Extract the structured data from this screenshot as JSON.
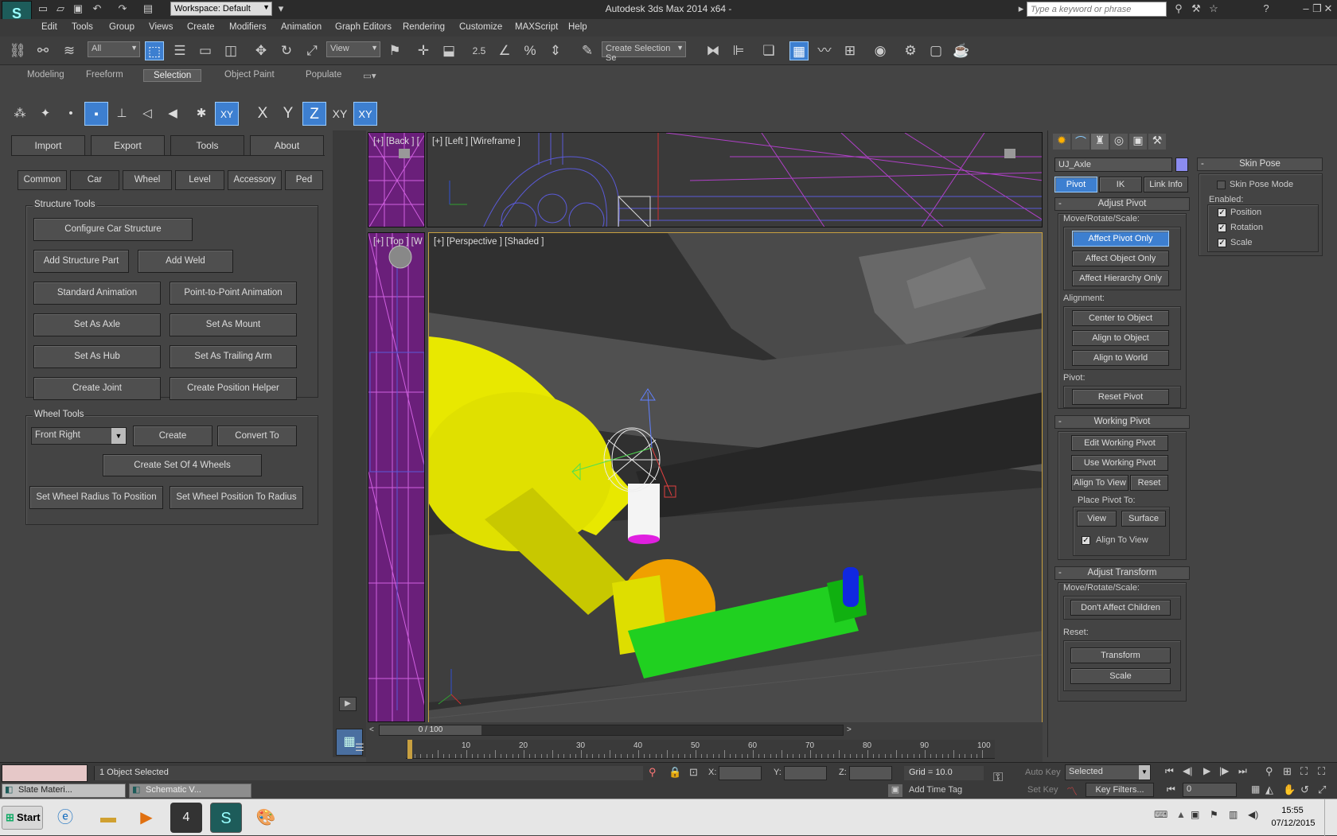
{
  "app": {
    "title": "Autodesk 3ds Max  2014 x64  -",
    "workspace_label": "Workspace: Default",
    "search_placeholder": "Type a keyword or phrase"
  },
  "menu": [
    "Edit",
    "Tools",
    "Group",
    "Views",
    "Create",
    "Modifiers",
    "Animation",
    "Graph Editors",
    "Rendering",
    "Customize",
    "MAXScript",
    "Help"
  ],
  "toolbar": {
    "filter_value": "All",
    "refcoord_value": "View",
    "selection_set_value": "Create Selection Se",
    "angle_snap_label": "2.5"
  },
  "ribbon_tabs": [
    "Modeling",
    "Freeform",
    "Selection",
    "Object Paint",
    "Populate"
  ],
  "ribbon_active": "Selection",
  "axis_buttons": [
    "X",
    "Y",
    "Z",
    "XY",
    "XY"
  ],
  "left_panel": {
    "tabs": [
      "Import",
      "Export",
      "Tools",
      "About"
    ],
    "active_tab": "Tools",
    "subtabs": [
      "Common",
      "Car",
      "Wheel",
      "Level",
      "Accessory",
      "Ped"
    ],
    "active_subtab": "Car",
    "structure_title": "Structure Tools",
    "structure_buttons": {
      "configure": "Configure Car Structure",
      "add_part": "Add Structure Part",
      "add_weld": "Add Weld",
      "std_anim": "Standard Animation",
      "p2p_anim": "Point-to-Point Animation",
      "set_axle": "Set As Axle",
      "set_mount": "Set As Mount",
      "set_hub": "Set As Hub",
      "set_trailing": "Set As Trailing Arm",
      "create_joint": "Create Joint",
      "create_pos_helper": "Create Position Helper"
    },
    "wheel_title": "Wheel Tools",
    "wheel_select_value": "Front Right",
    "wheel_buttons": {
      "create": "Create",
      "convert": "Convert To",
      "set_of_4": "Create Set Of 4 Wheels",
      "radius_to_pos": "Set Wheel Radius To Position",
      "pos_to_radius": "Set Wheel Position To Radius"
    }
  },
  "viewports": {
    "back": "[+] [Back ] [",
    "left": "[+] [Left ] [Wireframe ]",
    "top": "[+] [Top ] [W",
    "perspective": "[+] [Perspective ] [Shaded ]"
  },
  "command_panel": {
    "object_name": "UJ_Axle",
    "object_color": "#8c8cf0",
    "tabs": [
      "Pivot",
      "IK",
      "Link Info"
    ],
    "active_tab": "Pivot",
    "adjust_pivot_title": "Adjust Pivot",
    "move_rotate_scale": "Move/Rotate/Scale:",
    "affect_pivot_only": "Affect Pivot Only",
    "affect_object_only": "Affect Object Only",
    "affect_hierarchy_only": "Affect Hierarchy Only",
    "alignment": "Alignment:",
    "center_to_object": "Center to Object",
    "align_to_object": "Align to Object",
    "align_to_world": "Align to World",
    "pivot_label": "Pivot:",
    "reset_pivot": "Reset Pivot",
    "working_pivot_title": "Working Pivot",
    "edit_working_pivot": "Edit Working Pivot",
    "use_working_pivot": "Use Working Pivot",
    "align_to_view": "Align To View",
    "reset": "Reset",
    "place_pivot_to": "Place Pivot To:",
    "view": "View",
    "surface": "Surface",
    "align_to_view_check": "Align To View",
    "adjust_transform_title": "Adjust Transform",
    "move_rotate_scale2": "Move/Rotate/Scale:",
    "dont_affect_children": "Don't Affect Children",
    "reset_label": "Reset:",
    "transform": "Transform",
    "scale": "Scale"
  },
  "skin_pose": {
    "title": "Skin Pose",
    "skin_pose_mode": "Skin Pose Mode",
    "enabled": "Enabled:",
    "position": "Position",
    "rotation": "Rotation",
    "scale": "Scale"
  },
  "timeline": {
    "frame_display": "0 / 100",
    "ticks": [
      "10",
      "20",
      "30",
      "40",
      "50",
      "60",
      "70",
      "80",
      "90",
      "100"
    ]
  },
  "status": {
    "selection": "1 Object Selected",
    "x_label": "X:",
    "y_label": "Y:",
    "z_label": "Z:",
    "grid": "Grid = 10.0",
    "add_time_tag": "Add Time Tag",
    "auto_key": "Auto Key",
    "set_key": "Set Key",
    "key_mode_value": "Selected",
    "key_filters": "Key Filters...",
    "frame_value": "0"
  },
  "bottom_windows": [
    "Slate Materi...",
    "Schematic V..."
  ],
  "taskbar": {
    "start": "Start",
    "time": "15:55",
    "date": "07/12/2015"
  }
}
